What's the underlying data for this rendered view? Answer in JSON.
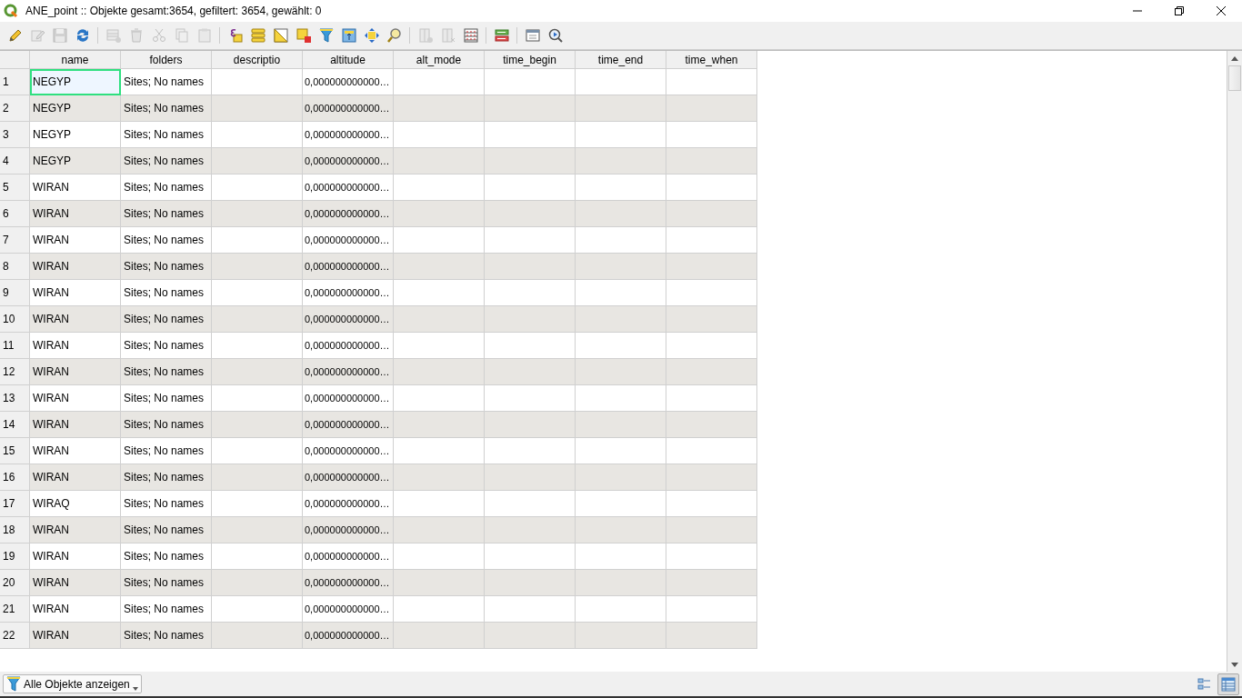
{
  "window": {
    "title": "ANE_point :: Objekte gesamt:3654, gefiltert: 3654, gewählt: 0"
  },
  "toolbar": [
    {
      "kind": "pencil",
      "disabled": false
    },
    {
      "kind": "multiedit",
      "disabled": true
    },
    {
      "kind": "save",
      "disabled": true
    },
    {
      "kind": "refresh",
      "disabled": false
    },
    {
      "kind": "separator"
    },
    {
      "kind": "addrow",
      "disabled": true
    },
    {
      "kind": "trash",
      "disabled": true
    },
    {
      "kind": "scissors",
      "disabled": true
    },
    {
      "kind": "copy",
      "disabled": true
    },
    {
      "kind": "paste",
      "disabled": true
    },
    {
      "kind": "separator"
    },
    {
      "kind": "expression",
      "disabled": false
    },
    {
      "kind": "selectall",
      "disabled": false
    },
    {
      "kind": "invert",
      "disabled": false
    },
    {
      "kind": "deselect",
      "disabled": false
    },
    {
      "kind": "filter",
      "disabled": false
    },
    {
      "kind": "totop",
      "disabled": false
    },
    {
      "kind": "pan",
      "disabled": false
    },
    {
      "kind": "zoom",
      "disabled": false
    },
    {
      "kind": "separator"
    },
    {
      "kind": "newfield",
      "disabled": true
    },
    {
      "kind": "delfield",
      "disabled": true
    },
    {
      "kind": "calculator",
      "disabled": false
    },
    {
      "kind": "separator"
    },
    {
      "kind": "conditional",
      "disabled": false
    },
    {
      "kind": "separator"
    },
    {
      "kind": "dock",
      "disabled": false
    },
    {
      "kind": "actions",
      "disabled": false
    }
  ],
  "table": {
    "columns": [
      "name",
      "folders",
      "descriptio",
      "altitude",
      "alt_mode",
      "time_begin",
      "time_end",
      "time_when"
    ],
    "rows": [
      {
        "number": "1",
        "name": "NEGYP",
        "folders": "Sites; No names",
        "altitude": "0,000000000000…",
        "focused": true
      },
      {
        "number": "2",
        "name": "NEGYP",
        "folders": "Sites; No names",
        "altitude": "0,000000000000…",
        "focused": false
      },
      {
        "number": "3",
        "name": "NEGYP",
        "folders": "Sites; No names",
        "altitude": "0,000000000000…",
        "focused": false
      },
      {
        "number": "4",
        "name": "NEGYP",
        "folders": "Sites; No names",
        "altitude": "0,000000000000…",
        "focused": false
      },
      {
        "number": "5",
        "name": "WIRAN",
        "folders": "Sites; No names",
        "altitude": "0,000000000000…",
        "focused": false
      },
      {
        "number": "6",
        "name": "WIRAN",
        "folders": "Sites; No names",
        "altitude": "0,000000000000…",
        "focused": false
      },
      {
        "number": "7",
        "name": "WIRAN",
        "folders": "Sites; No names",
        "altitude": "0,000000000000…",
        "focused": false
      },
      {
        "number": "8",
        "name": "WIRAN",
        "folders": "Sites; No names",
        "altitude": "0,000000000000…",
        "focused": false
      },
      {
        "number": "9",
        "name": "WIRAN",
        "folders": "Sites; No names",
        "altitude": "0,000000000000…",
        "focused": false
      },
      {
        "number": "10",
        "name": "WIRAN",
        "folders": "Sites; No names",
        "altitude": "0,000000000000…",
        "focused": false
      },
      {
        "number": "11",
        "name": "WIRAN",
        "folders": "Sites; No names",
        "altitude": "0,000000000000…",
        "focused": false
      },
      {
        "number": "12",
        "name": "WIRAN",
        "folders": "Sites; No names",
        "altitude": "0,000000000000…",
        "focused": false
      },
      {
        "number": "13",
        "name": "WIRAN",
        "folders": "Sites; No names",
        "altitude": "0,000000000000…",
        "focused": false
      },
      {
        "number": "14",
        "name": "WIRAN",
        "folders": "Sites; No names",
        "altitude": "0,000000000000…",
        "focused": false
      },
      {
        "number": "15",
        "name": "WIRAN",
        "folders": "Sites; No names",
        "altitude": "0,000000000000…",
        "focused": false
      },
      {
        "number": "16",
        "name": "WIRAN",
        "folders": "Sites; No names",
        "altitude": "0,000000000000…",
        "focused": false
      },
      {
        "number": "17",
        "name": "WIRAQ",
        "folders": "Sites; No names",
        "altitude": "0,000000000000…",
        "focused": false
      },
      {
        "number": "18",
        "name": "WIRAN",
        "folders": "Sites; No names",
        "altitude": "0,000000000000…",
        "focused": false
      },
      {
        "number": "19",
        "name": "WIRAN",
        "folders": "Sites; No names",
        "altitude": "0,000000000000…",
        "focused": false
      },
      {
        "number": "20",
        "name": "WIRAN",
        "folders": "Sites; No names",
        "altitude": "0,000000000000…",
        "focused": false
      },
      {
        "number": "21",
        "name": "WIRAN",
        "folders": "Sites; No names",
        "altitude": "0,000000000000…",
        "focused": false
      },
      {
        "number": "22",
        "name": "WIRAN",
        "folders": "Sites; No names",
        "altitude": "0,000000000000…",
        "focused": false
      }
    ]
  },
  "bottom_bar": {
    "filter_button": "Alle Objekte anzeigen",
    "view_modes": [
      {
        "kind": "form",
        "selected": false
      },
      {
        "kind": "table",
        "selected": true
      }
    ]
  }
}
